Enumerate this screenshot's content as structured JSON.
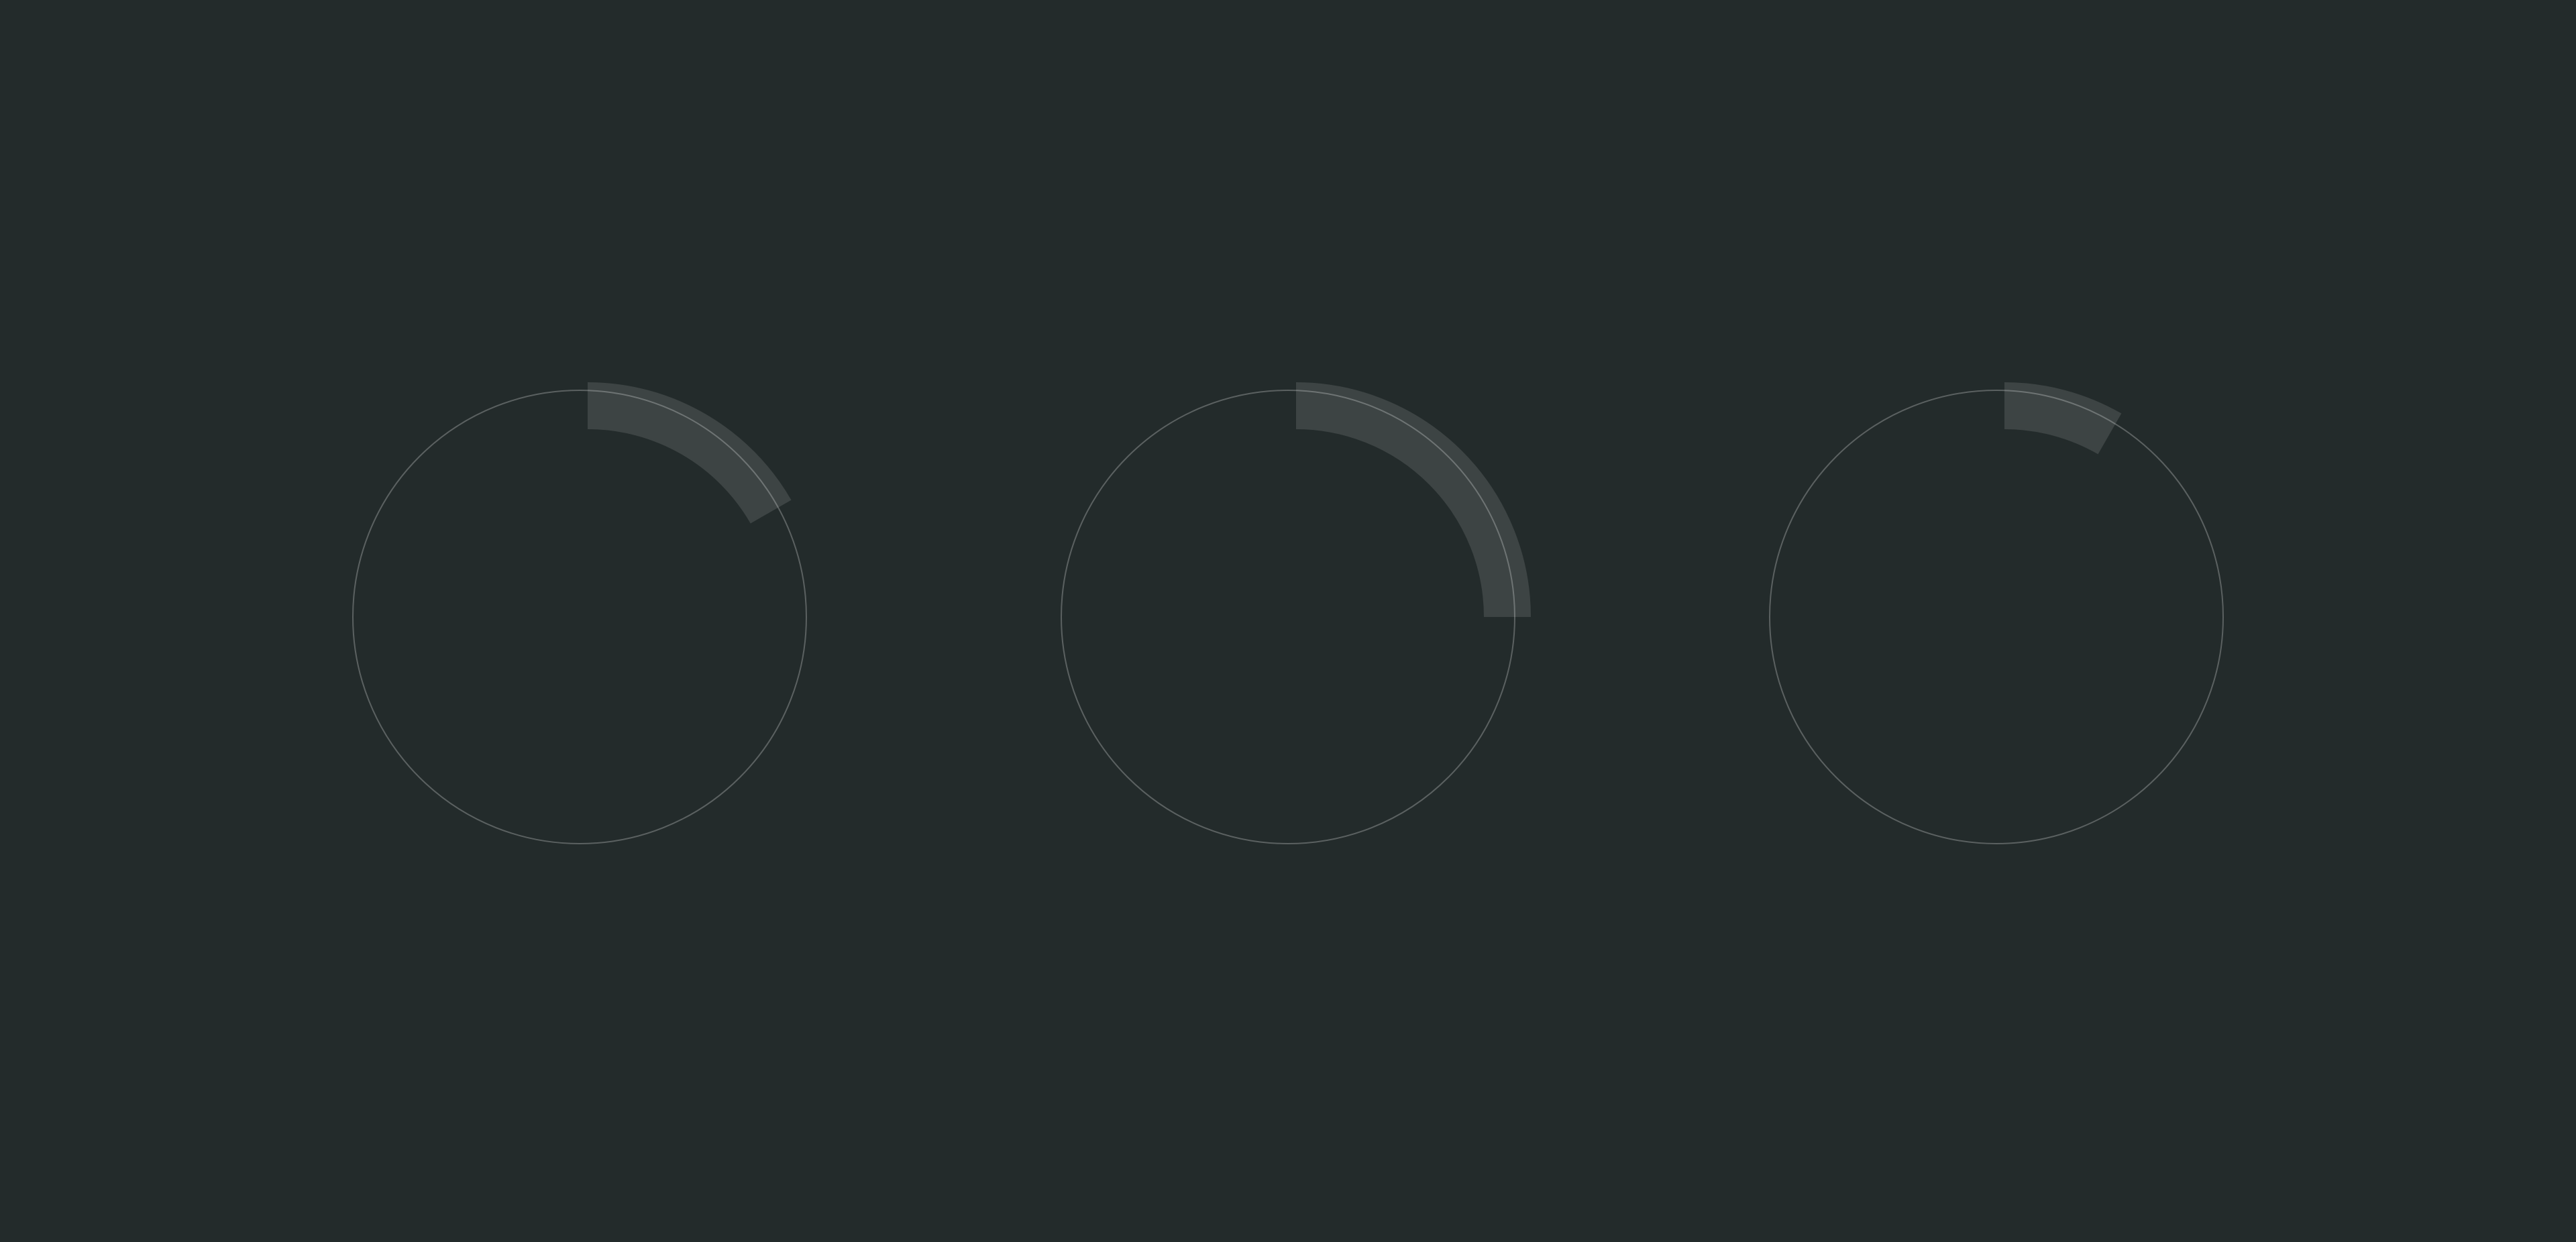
{
  "colors": {
    "background": "#232b2b",
    "ring_outline": "#5b6161",
    "progress_fill": "rgba(255,255,255,0.12)"
  },
  "indicators": [
    {
      "name": "progress-ring-1",
      "progress": 0.167
    },
    {
      "name": "progress-ring-2",
      "progress": 0.25
    },
    {
      "name": "progress-ring-3",
      "progress": 0.083
    }
  ]
}
